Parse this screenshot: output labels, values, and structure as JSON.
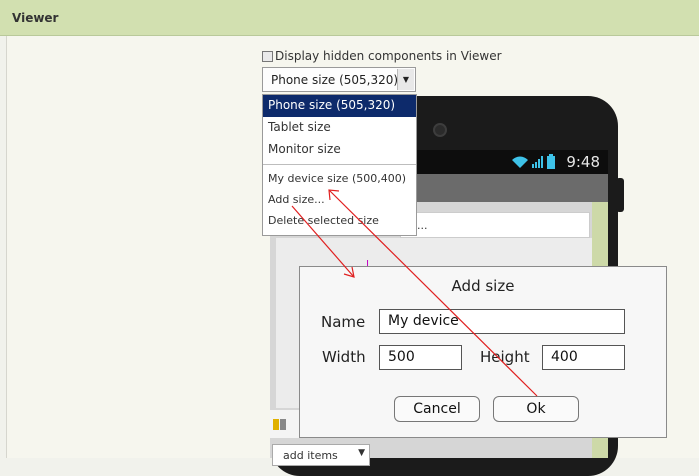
{
  "viewer": {
    "title": "Viewer"
  },
  "hidden_checkbox": {
    "label": "Display hidden components in Viewer",
    "checked": false
  },
  "size_select": {
    "value": "Phone size (505,320)",
    "options": [
      "Phone size (505,320)",
      "Tablet size",
      "Monitor size",
      "My device size (500,400)",
      "Add size...",
      "Delete selected size"
    ]
  },
  "phone": {
    "time": "9:48",
    "textbox_hint": "...",
    "add_items": "add items"
  },
  "dialog": {
    "title": "Add size",
    "name_label": "Name",
    "name_value": "My device",
    "width_label": "Width",
    "width_value": "500",
    "height_label": "Height",
    "height_value": "400",
    "cancel": "Cancel",
    "ok": "Ok"
  },
  "colors": {
    "header": "#d2e0b0",
    "selected_item": "#0d2a6b",
    "annotation_arrow": "#e02020"
  }
}
